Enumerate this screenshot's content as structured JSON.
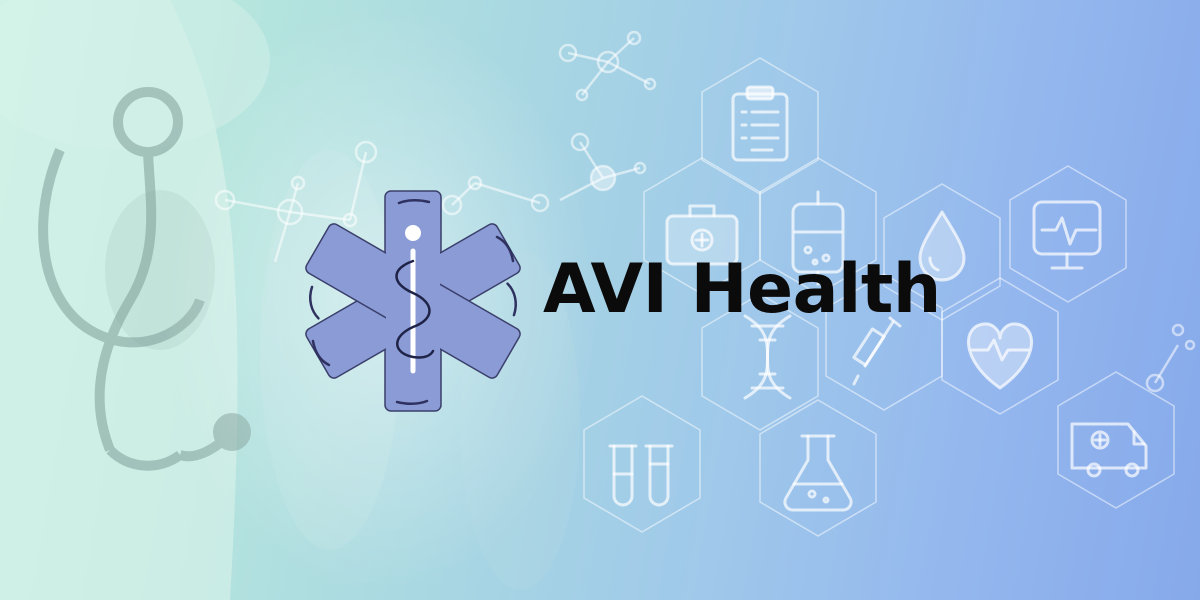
{
  "brand": {
    "name": "AVI Health",
    "text_color": "#0b0b0b",
    "logo_icon": "star-of-life-icon",
    "logo_color": "#8a9bd6"
  },
  "background": {
    "gradient_start": "#bfeee0",
    "gradient_end": "#86a9ea",
    "photo_subject": "doctor-holding-stethoscope",
    "icons": [
      "clipboard-icon",
      "first-aid-kit-icon",
      "iv-bag-icon",
      "blood-drop-icon",
      "heart-monitor-icon",
      "dna-icon",
      "syringe-icon",
      "heartbeat-heart-icon",
      "test-tubes-icon",
      "flask-icon",
      "ambulance-icon",
      "molecule-icon"
    ]
  }
}
